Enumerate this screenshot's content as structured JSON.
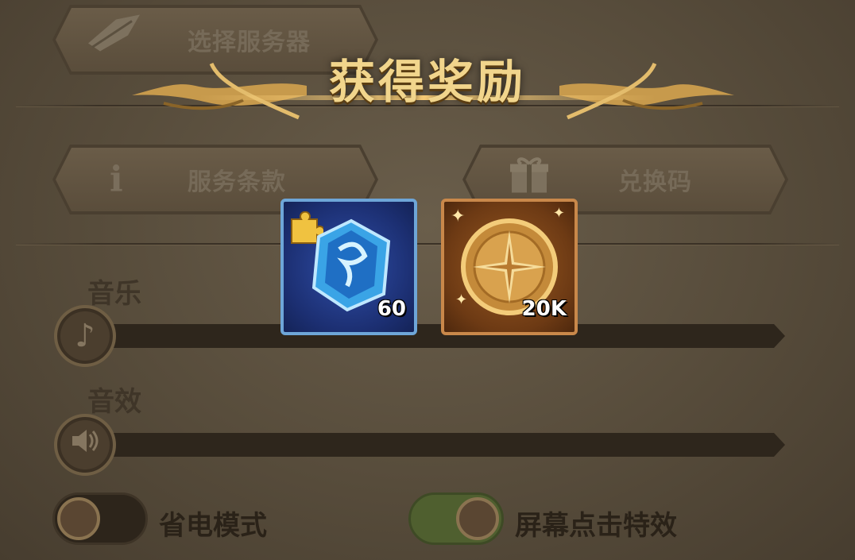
{
  "settings": {
    "select_server": "选择服务器",
    "terms": "服务条款",
    "redeem_code": "兑换码",
    "music_label": "音乐",
    "sfx_label": "音效",
    "power_saving_label": "省电模式",
    "screen_tap_effect_label": "屏幕点击特效",
    "power_saving_on": false,
    "screen_tap_effect_on": true
  },
  "reward_popup": {
    "title": "获得奖励",
    "items": [
      {
        "icon": "blue-crystal-shard-icon",
        "count": "60"
      },
      {
        "icon": "gold-compass-coin-icon",
        "count": "20K"
      }
    ]
  },
  "colors": {
    "title_gold": "#f1d58c",
    "toggle_on": "#4f5f2f",
    "reward_blue_border": "#6ea6d8",
    "reward_gold_border": "#c9884a"
  }
}
